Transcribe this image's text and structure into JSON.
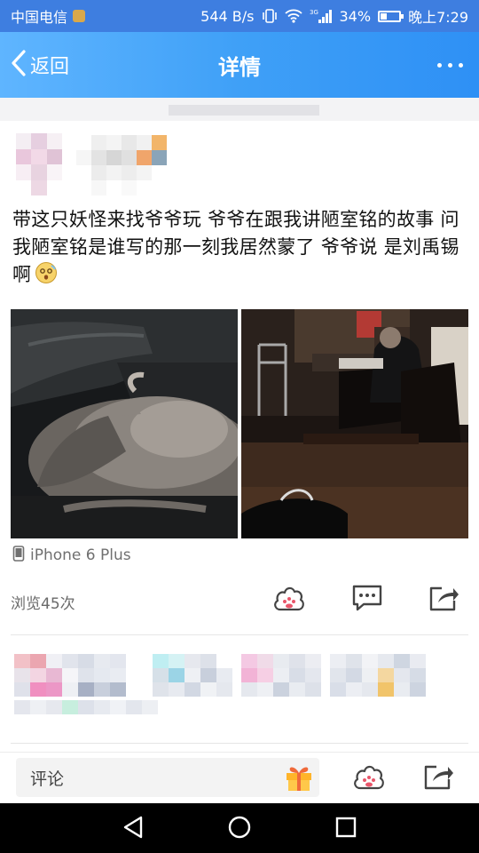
{
  "status_bar": {
    "carrier": "中国电信",
    "net_speed": "544 B/s",
    "network_type": "3G",
    "battery_percent": "34%",
    "battery_level": 0.34,
    "time": "晚上7:29"
  },
  "header": {
    "back_label": "返回",
    "title": "详情",
    "more_icon": "more-dots-icon"
  },
  "post": {
    "text": "带这只妖怪来找爷爷玩  爷爷在跟我讲陋室铭的故事  问我陋室铭是谁写的那一刻我居然蒙了  爷爷说 是刘禹锡啊",
    "emoji": "dizzy-face-emoji",
    "device": "iPhone 6 Plus",
    "views": "浏览45次"
  },
  "comment_bar": {
    "placeholder": "评论"
  },
  "colors": {
    "status_bar_bg": "#3e7ee0",
    "header_bg": "#3fa0f7",
    "header_text": "#ffffff",
    "icon_gray": "#444444",
    "nav_bg": "#000000"
  }
}
